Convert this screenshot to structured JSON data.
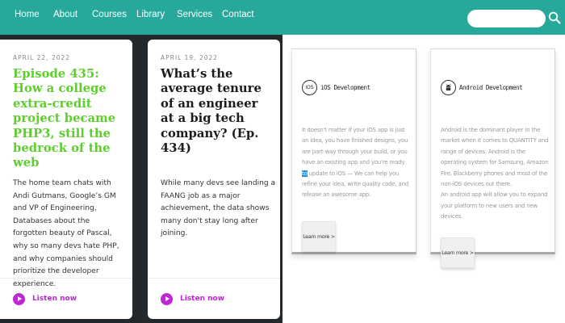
{
  "nav": {
    "items": [
      "Home",
      "About",
      "Courses",
      "Library",
      "Services",
      "Contact"
    ],
    "search_placeholder": "",
    "search_icon": "search-icon",
    "bar_color": "#26a99a"
  },
  "posts": [
    {
      "date": "APRIL 22, 2022",
      "title": "Episode 435: How a college extra-credit project became PHP3, still the bedrock of the web",
      "body": "The home team chats with Andi Gutmans, Google’s GM and VP of Engineering, Databases about the forgotten beauty of Pascal, why so many devs hate PHP, and why companies should prioritize the developer experience.",
      "action": "Listen now",
      "title_color": "#5fce2d"
    },
    {
      "date": "APRIL 19, 2022",
      "title": "What’s the average tenure of an engineer at a big tech company? (Ep. 434)",
      "body": "While many devs see landing a FAANG job as a major achievement, the data shows many don't stay long after joining.",
      "action": "Listen now",
      "title_color": "#1c1c1c"
    }
  ],
  "accent_color": "#c025d6",
  "courses": [
    {
      "icon_text": "iOS",
      "title": "iOS Development",
      "desc_before": "It doesn't matter if your iOS app is just an idea, you have finished designs, you are part-way through your build, or you have an existing app and you're ready ",
      "desc_highlight": "to",
      "desc_after": " update to iOS — We can help you refine your idea, write quality code, and release an awesome app.",
      "button": "Learn more >"
    },
    {
      "icon_text": "android",
      "title": "Android Development",
      "desc_before": "Android is the dominant player in the market when it comes to QUANTITY and range of devices. Android is the operating system for Samsung, Amazon Fire, Blackberry phones and most of the non-iOS devices out there.",
      "desc_highlight": "",
      "desc_after": "",
      "desc_extra": "An android app will allow you to expand your platform to new users and new devices.",
      "button": "Learn more >"
    }
  ]
}
